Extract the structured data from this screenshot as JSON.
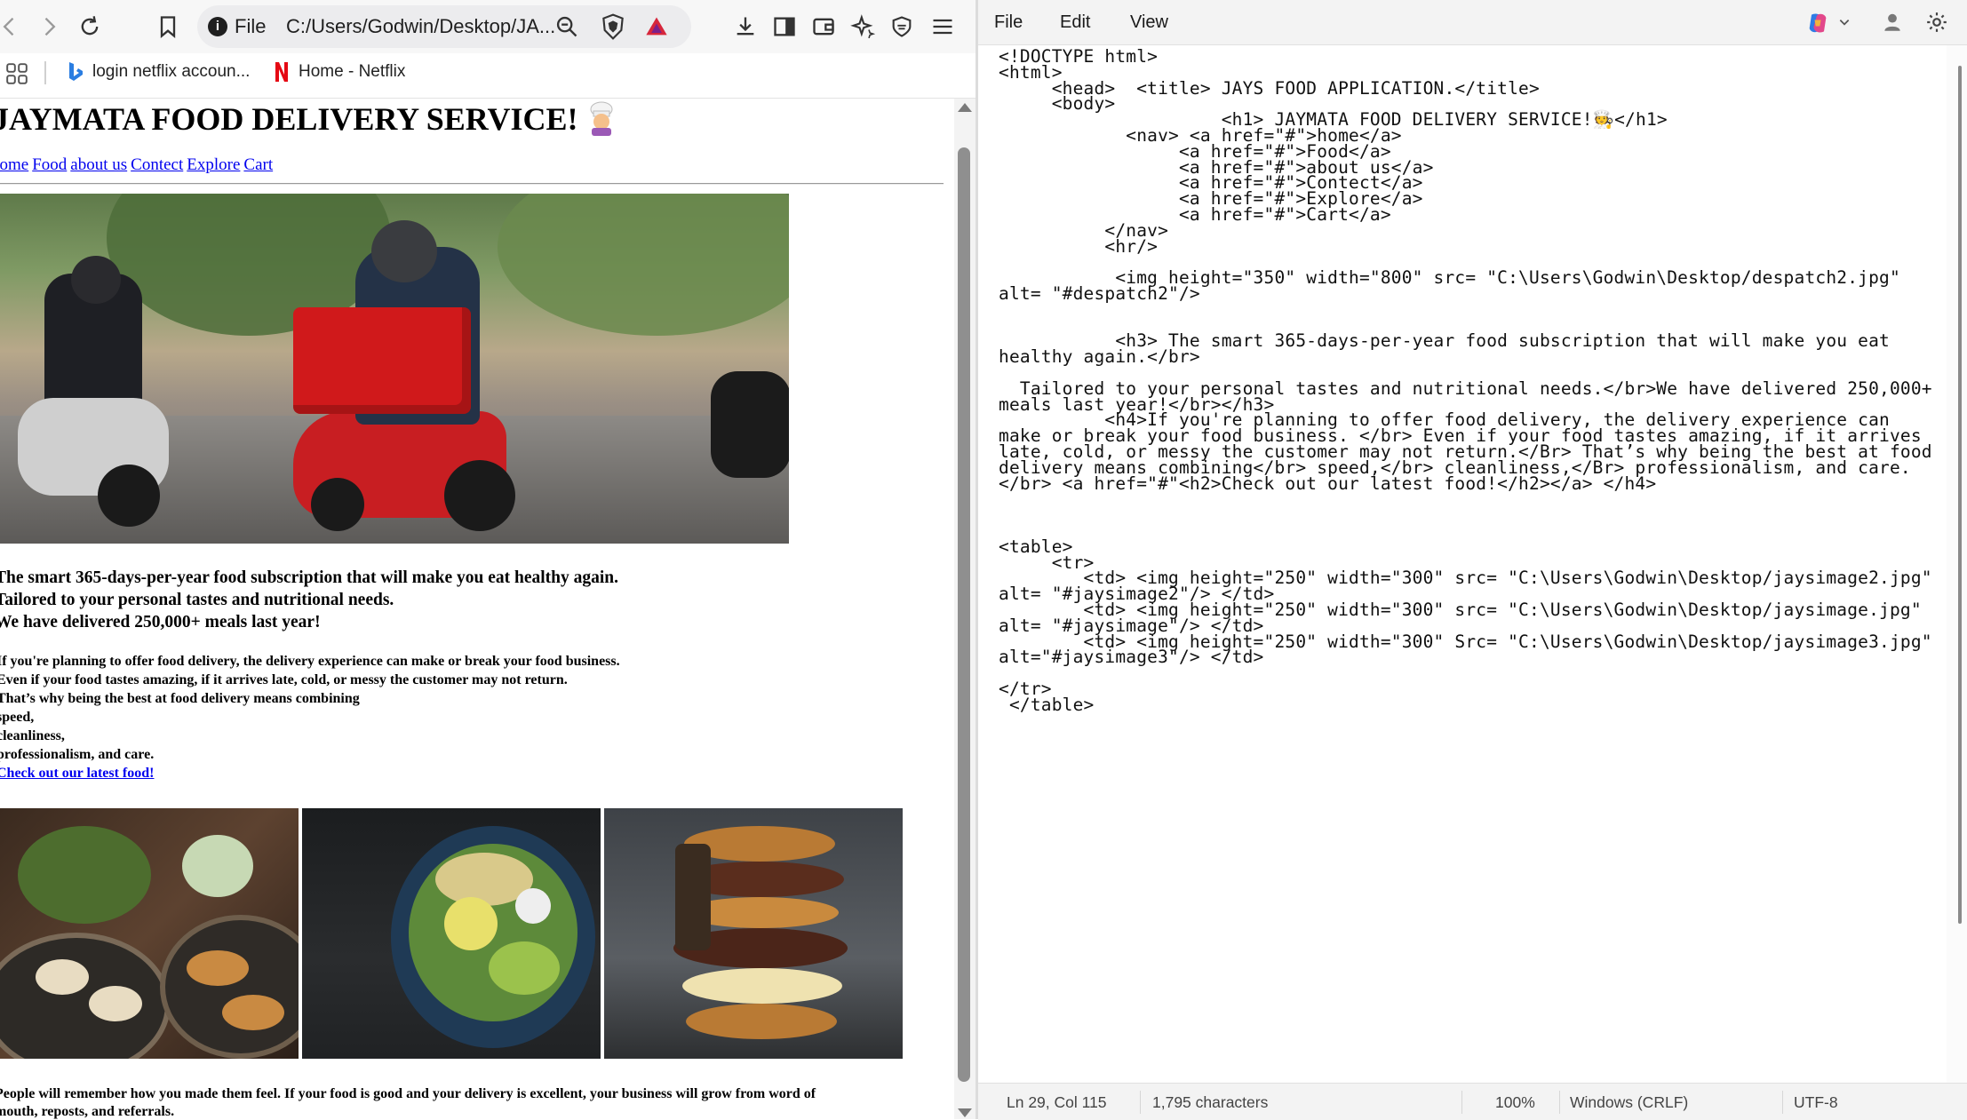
{
  "browser": {
    "address_scheme": "File",
    "address_url": "C:/Users/Godwin/Desktop/JA...",
    "bookmarks": [
      {
        "label": "login netflix accoun...",
        "icon": "bing-icon"
      },
      {
        "label": "Home - Netflix",
        "icon": "netflix-icon"
      }
    ]
  },
  "page": {
    "h1": "JAYMATA FOOD DELIVERY SERVICE!",
    "nav": [
      "home",
      "Food",
      "about us",
      "Contect",
      "Explore",
      "Cart"
    ],
    "h3_lines": [
      "The smart 365-days-per-year food subscription that will make you eat healthy again.",
      "Tailored to your personal tastes and nutritional needs.",
      "We have delivered 250,000+ meals last year!"
    ],
    "h4_lines": [
      "If you're planning to offer food delivery, the delivery experience can make or break your food business.",
      "Even if your food tastes amazing, if it arrives late, cold, or messy the customer may not return.",
      "That’s why being the best at food delivery means combining",
      "speed,",
      "cleanliness,",
      "professionalism, and care."
    ],
    "h4_link": "Check out our latest food!",
    "paragraph_lines": [
      "People will remember how you made them feel. If your food is good and your delivery is excellent, your business will grow from word of",
      "mouth, reposts, and referrals."
    ]
  },
  "editor": {
    "menu": [
      "File",
      "Edit",
      "View"
    ],
    "code_lines": [
      "<!DOCTYPE html>",
      "<html>",
      "     <head>  <title> JAYS FOOD APPLICATION.</title>",
      "     <body>",
      "                     <h1> JAYMATA FOOD DELIVERY SERVICE!🧑‍🍳</h1>",
      "            <nav> <a href=\"#\">home</a>",
      "                 <a href=\"#\">Food</a>",
      "                 <a href=\"#\">about us</a>",
      "                 <a href=\"#\">Contect</a>",
      "                 <a href=\"#\">Explore</a>",
      "                 <a href=\"#\">Cart</a>",
      "          </nav>",
      "          <hr/>",
      "",
      "           <img height=\"350\" width=\"800\" src= \"C:\\Users\\Godwin\\Desktop/despatch2.jpg\"",
      "alt= \"#despatch2\"/>",
      "",
      "",
      "           <h3> The smart 365-days-per-year food subscription that will make you eat",
      "healthy again.</br>",
      "",
      "  Tailored to your personal tastes and nutritional needs.</br>We have delivered 250,000+",
      "meals last year!</br></h3>",
      "          <h4>If you're planning to offer food delivery, the delivery experience can",
      "make or break your food business. </br> Even if your food tastes amazing, if it arrives",
      "late, cold, or messy the customer may not return.</Br> That’s why being the best at food",
      "delivery means combining</br> speed,</br> cleanliness,</Br> professionalism, and care.",
      "</br> <a href=\"#\"<h2>Check out our latest food!</h2></a> </h4>",
      "",
      "",
      "",
      "<table>",
      "     <tr>",
      "        <td> <img height=\"250\" width=\"300\" src= \"C:\\Users\\Godwin\\Desktop/jaysimage2.jpg\"",
      "alt= \"#jaysimage2\"/> </td>",
      "        <td> <img height=\"250\" width=\"300\" src= \"C:\\Users\\Godwin\\Desktop/jaysimage.jpg\"",
      "alt= \"#jaysimage\"/> </td>",
      "        <td> <img height=\"250\" width=\"300\" Src= \"C:\\Users\\Godwin\\Desktop/jaysimage3.jpg\"",
      "alt=\"#jaysimage3\"/> </td>",
      "",
      "</tr>",
      " </table>"
    ],
    "status": {
      "position": "Ln 29, Col 115",
      "chars": "1,795 characters",
      "zoom": "100%",
      "line_ending": "Windows (CRLF)",
      "encoding": "UTF-8"
    }
  }
}
